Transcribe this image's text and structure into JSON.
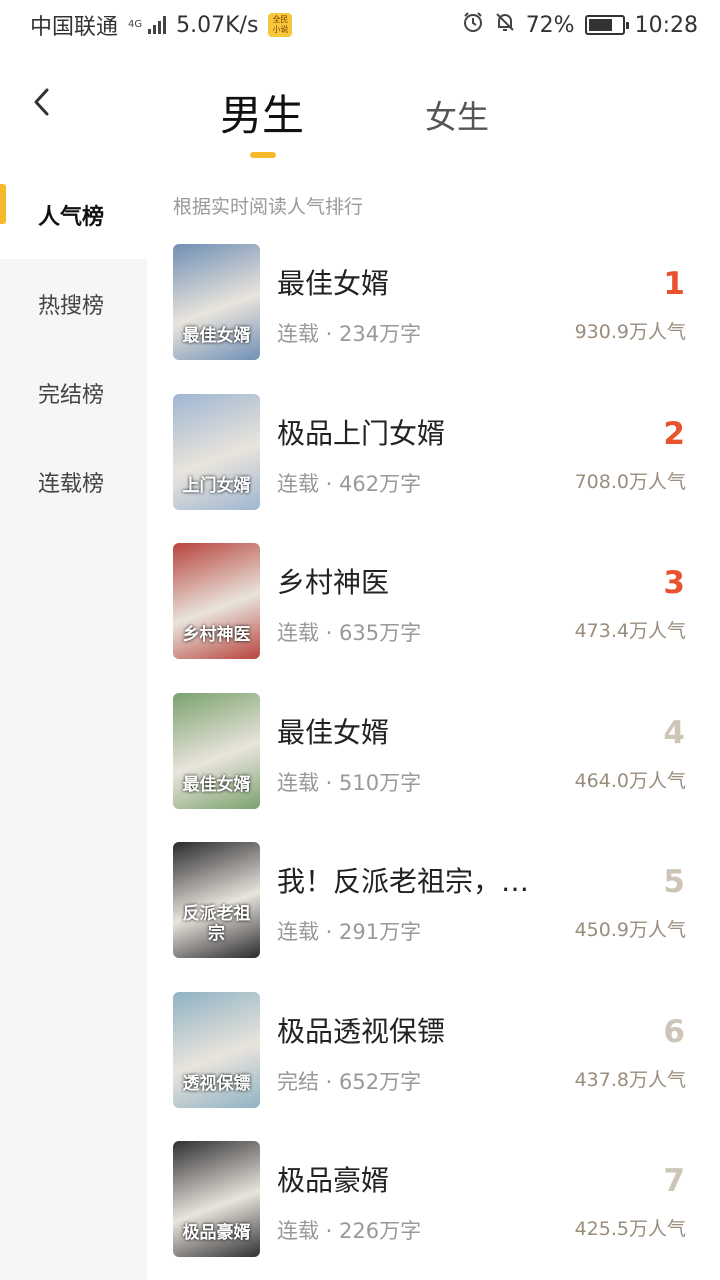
{
  "status_bar": {
    "carrier": "中国联通",
    "network": "4G",
    "speed": "5.07K/s",
    "app_badge": "全民小说",
    "battery": "72%",
    "battery_level": 0.72,
    "time": "10:28"
  },
  "header": {
    "back_icon": "chevron-left-icon",
    "tabs": [
      {
        "label": "男生",
        "active": true
      },
      {
        "label": "女生",
        "active": false
      }
    ],
    "accent": "#f6b92b"
  },
  "sidebar": {
    "items": [
      {
        "label": "人气榜",
        "active": true
      },
      {
        "label": "热搜榜",
        "active": false
      },
      {
        "label": "完结榜",
        "active": false
      },
      {
        "label": "连载榜",
        "active": false
      }
    ]
  },
  "main": {
    "subtitle": "根据实时阅读人气排行",
    "books": [
      {
        "rank": "1",
        "title": "最佳女婿",
        "meta": "连载 · 234万字",
        "popularity": "930.9万人气",
        "cover_text": "最佳女婿",
        "cover_color": "#6f8fb5"
      },
      {
        "rank": "2",
        "title": "极品上门女婿",
        "meta": "连载 · 462万字",
        "popularity": "708.0万人气",
        "cover_text": "上门女婿",
        "cover_color": "#9fb6d2"
      },
      {
        "rank": "3",
        "title": "乡村神医",
        "meta": "连载 · 635万字",
        "popularity": "473.4万人气",
        "cover_text": "乡村神医",
        "cover_color": "#b7443d"
      },
      {
        "rank": "4",
        "title": "最佳女婿",
        "meta": "连载 · 510万字",
        "popularity": "464.0万人气",
        "cover_text": "最佳女婿",
        "cover_color": "#7aa26e"
      },
      {
        "rank": "5",
        "title": "我！反派老祖宗，…",
        "meta": "连载 · 291万字",
        "popularity": "450.9万人气",
        "cover_text": "反派老祖宗",
        "cover_color": "#2a2a2e"
      },
      {
        "rank": "6",
        "title": "极品透视保镖",
        "meta": "完结 · 652万字",
        "popularity": "437.8万人气",
        "cover_text": "透视保镖",
        "cover_color": "#8fb2c4"
      },
      {
        "rank": "7",
        "title": "极品豪婿",
        "meta": "连载 · 226万字",
        "popularity": "425.5万人气",
        "cover_text": "极品豪婿",
        "cover_color": "#303033"
      }
    ],
    "top_rank_color": "#e8522f",
    "rank_color": "#ccc5b8"
  }
}
